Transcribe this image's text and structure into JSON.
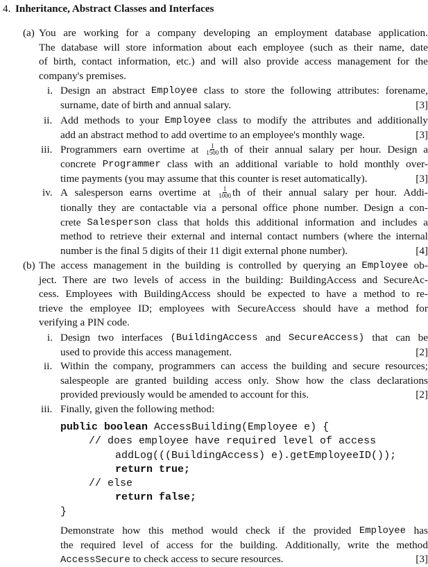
{
  "question": {
    "number": "4.",
    "title": "Inheritance, Abstract Classes and Interfaces"
  },
  "part_a": {
    "label": "(a)",
    "intro": [
      [
        "You",
        "are",
        "working",
        "for",
        "a",
        "company",
        "developing",
        "an",
        "employment",
        "database",
        "application."
      ],
      [
        "The",
        "database",
        "will",
        "store",
        "information",
        "about",
        "each",
        "employee",
        "(such",
        "as",
        "their",
        "name,",
        "date"
      ],
      [
        "of",
        "birth,",
        "contact",
        "information,",
        "etc.)",
        "and",
        "will",
        "also",
        "provide",
        "access",
        "management",
        "for",
        "the"
      ],
      [
        "company's premises."
      ]
    ],
    "items": [
      {
        "label": "i.",
        "lines": [
          [
            "Design",
            "an",
            "abstract",
            "Employee",
            "class",
            "to",
            "store",
            "the",
            "following",
            "attributes:",
            "forename,"
          ],
          [
            "surname, date of birth and annual salary."
          ]
        ],
        "marks": "[3]"
      },
      {
        "label": "ii.",
        "lines": [
          [
            "Add",
            "methods",
            "to",
            "your",
            "Employee",
            "class",
            "to",
            "modify",
            "the",
            "attributes",
            "and",
            "additionally"
          ],
          [
            "add an abstract method to add overtime to an employee's monthly wage."
          ]
        ],
        "marks": "[3]"
      },
      {
        "label": "iii.",
        "line1_start": [
          "Programmers",
          "earn",
          "overtime",
          "at"
        ],
        "frac_num": "1",
        "frac_den": "1500",
        "line1_end": [
          "th",
          "of",
          "their",
          "annual",
          "salary",
          "per",
          "hour.",
          "Design",
          "a"
        ],
        "lines": [
          [
            "concrete",
            "Programmer",
            "class",
            "with",
            "an",
            "additional",
            "variable",
            "to",
            "hold",
            "monthly",
            "over-"
          ],
          [
            "time payments (you may assume that this counter is reset automatically)."
          ]
        ],
        "marks": "[3]"
      },
      {
        "label": "iv.",
        "line1_start": [
          "A",
          "salesperson",
          "earns",
          "overtime",
          "at"
        ],
        "frac_num": "1",
        "frac_den": "1000",
        "line1_end": [
          "th",
          "of",
          "their",
          "annual",
          "salary",
          "per",
          "hour.",
          "Addi-"
        ],
        "lines": [
          [
            "tionally",
            "they",
            "are",
            "contactable",
            "via",
            "a",
            "personal",
            "office",
            "phone",
            "number.",
            "Design",
            "a",
            "con-"
          ],
          [
            "crete",
            "Salesperson",
            "class",
            "that",
            "holds",
            "this",
            "additional",
            "information",
            "and",
            "includes",
            "a"
          ],
          [
            "method",
            "to",
            "retrieve",
            "their",
            "external",
            "and",
            "internal",
            "contact",
            "numbers",
            "(where",
            "the",
            "internal"
          ],
          [
            "number is the final 5 digits of their 11 digit external phone number)."
          ]
        ],
        "marks": "[4]"
      }
    ]
  },
  "part_b": {
    "label": "(b)",
    "intro": [
      [
        "The",
        "access",
        "management",
        "in",
        "the",
        "building",
        "is",
        "controlled",
        "by",
        "querying",
        "an",
        "Employee",
        "ob-"
      ],
      [
        "ject.",
        "There",
        "are",
        "two",
        "levels",
        "of",
        "access",
        "in",
        "the",
        "building:",
        "BuildingAccess",
        "and",
        "SecureAc-"
      ],
      [
        "cess.",
        "Employees",
        "with",
        "BuildingAccess",
        "should",
        "be",
        "expected",
        "to",
        "have",
        "a",
        "method",
        "to",
        "re-"
      ],
      [
        "trieve",
        "the",
        "employee",
        "ID;",
        "employees",
        "with",
        "SecureAccess",
        "should",
        "have",
        "a",
        "method",
        "for"
      ],
      [
        "verifying a PIN code."
      ]
    ],
    "items": [
      {
        "label": "i.",
        "lines": [
          [
            "Design",
            "two",
            "interfaces",
            "(BuildingAccess",
            "and",
            "SecureAccess)",
            "that",
            "can",
            "be"
          ],
          [
            "used to provide this access management."
          ]
        ],
        "marks": "[2]"
      },
      {
        "label": "ii.",
        "lines": [
          [
            "Within",
            "the",
            "company,",
            "programmers",
            "can",
            "access",
            "the",
            "building",
            "and",
            "secure",
            "resources;"
          ],
          [
            "salespeople",
            "are",
            "granted",
            "building",
            "access",
            "only.",
            "Show",
            "how",
            "the",
            "class",
            "declarations"
          ],
          [
            "provided previously would be amended to account for this."
          ]
        ],
        "marks": "[2]"
      },
      {
        "label": "iii.",
        "intro": "Finally, given the following method:",
        "code": {
          "l1_kw": "public boolean",
          "l1_rest": " AccessBuilding(Employee e) {",
          "l2": "// does employee have required level of access",
          "l3": "addLog(((BuildingAccess) e).getEmployeeID());",
          "l4": "return true;",
          "l5": "// else",
          "l6": "return false;",
          "l7": "}"
        },
        "after": [
          [
            "Demonstrate",
            "how",
            "this",
            "method",
            "would",
            "check",
            "if",
            "the",
            "provided",
            "Employee",
            "has"
          ],
          [
            "the",
            "required",
            "level",
            "of",
            "access",
            "for",
            "the",
            "building.",
            "Additionally,",
            "write",
            "the",
            "method"
          ],
          [
            "AccessSecure to check access to secure resources."
          ]
        ],
        "marks": "[3]"
      }
    ]
  },
  "mono_words": [
    "Employee",
    "Programmer",
    "Salesperson",
    "(BuildingAccess",
    "SecureAccess)",
    "AccessSecure"
  ]
}
